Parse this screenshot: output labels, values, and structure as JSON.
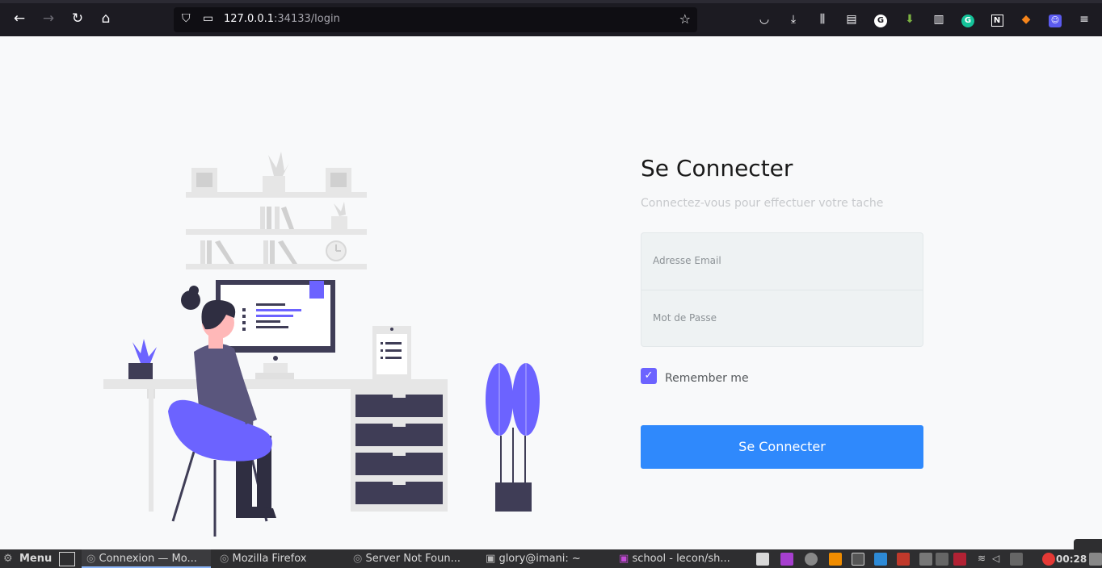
{
  "browser": {
    "url_host": "127.0.0.1",
    "url_rest": ":34133/login"
  },
  "login": {
    "title": "Se Connecter",
    "subtitle": "Connectez-vous pour effectuer votre tache",
    "email_placeholder": "Adresse Email",
    "password_placeholder": "Mot de Passe",
    "remember_label": "Remember me",
    "remember_checked": true,
    "submit_label": "Se Connecter"
  },
  "taskbar": {
    "menu_label": "Menu",
    "windows": [
      {
        "label": "Connexion — Mo..."
      },
      {
        "label": "Mozilla Firefox"
      },
      {
        "label": "Server Not Foun..."
      },
      {
        "label": "glory@imani: ~"
      },
      {
        "label": "school - lecon/sh..."
      }
    ],
    "clock": "00:28"
  },
  "colors": {
    "accent": "#2f89fc",
    "illustration_purple": "#6c63ff",
    "dark": "#3f3d56"
  }
}
